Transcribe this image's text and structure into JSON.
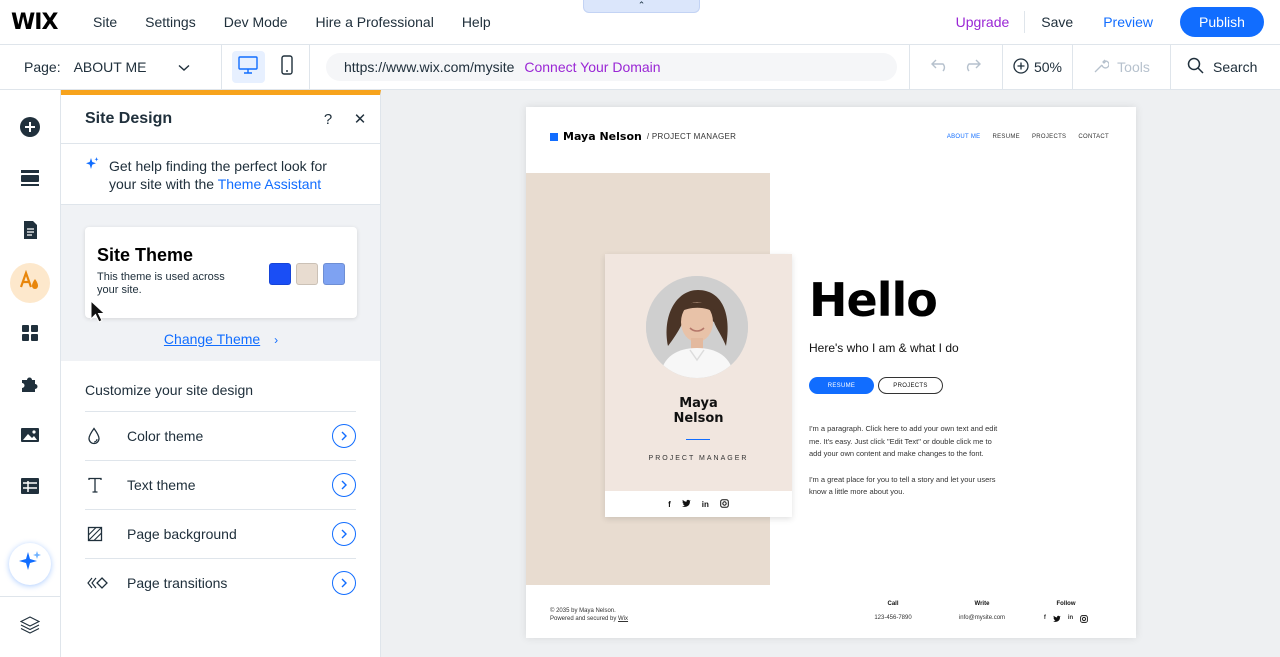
{
  "topbar": {
    "logo": "WIX",
    "menu": [
      "Site",
      "Settings",
      "Dev Mode",
      "Hire a Professional",
      "Help"
    ],
    "handle_glyph": "⌃",
    "upgrade": "Upgrade",
    "save": "Save",
    "preview": "Preview",
    "publish": "Publish"
  },
  "secbar": {
    "page_label": "Page:",
    "page_value": "ABOUT ME",
    "url": "https://www.wix.com/mysite",
    "connect_domain": "Connect Your Domain",
    "zoom": "50%",
    "tools": "Tools",
    "search": "Search"
  },
  "panel": {
    "title": "Site Design",
    "help_glyph": "?",
    "close_glyph": "✕",
    "assist_text": "Get help finding the perfect look for your site with the ",
    "assist_link": "Theme Assistant",
    "theme_title": "Site Theme",
    "theme_desc": "This theme is used across your site.",
    "change_theme": "Change Theme",
    "change_chevron": "›",
    "customize_title": "Customize your site design",
    "options": [
      {
        "label": "Color theme",
        "icon": "droplet-icon"
      },
      {
        "label": "Text theme",
        "icon": "text-icon"
      },
      {
        "label": "Page background",
        "icon": "background-icon"
      },
      {
        "label": "Page transitions",
        "icon": "transitions-icon"
      }
    ]
  },
  "colors": {
    "accent": "#116dff",
    "orange": "#f7a31c",
    "swatch1": "#1a4ef5",
    "swatch2": "#e8dcd0",
    "swatch3": "#7ea2f2"
  },
  "site": {
    "name": "Maya Nelson",
    "role": "/ PROJECT MANAGER",
    "nav": [
      "ABOUT ME",
      "RESUME",
      "PROJECTS",
      "CONTACT"
    ],
    "card_first": "Maya",
    "card_last": "Nelson",
    "card_role": "PROJECT MANAGER",
    "social": [
      "f",
      "t",
      "in",
      "ig"
    ],
    "hello": "Hello",
    "sub": "Here's who I am & what I do",
    "btn_resume": "RESUME",
    "btn_projects": "PROJECTS",
    "para1": "I'm a paragraph. Click here to add your own text and edit me. It's easy. Just click \"Edit Text\" or double click me to add your own content and make changes to the font.",
    "para2": "I'm a great place for you to tell a story and let your users know a little more about you.",
    "footer_copy": "© 2035 by Maya Nelson.",
    "footer_powered": "Powered and secured by ",
    "footer_wix": "Wix",
    "call_h": "Call",
    "call_v": "123-456-7890",
    "write_h": "Write",
    "write_v": "info@mysite.com",
    "follow_h": "Follow"
  }
}
